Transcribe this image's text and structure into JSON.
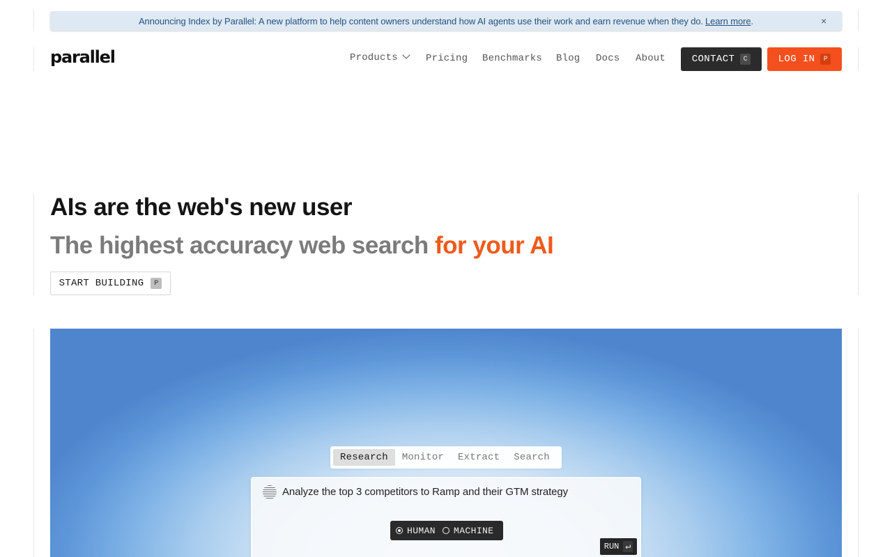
{
  "announcement": {
    "text": "Announcing Index by Parallel: A new platform to help content owners understand how AI agents use their work and earn revenue when they do.",
    "link_label": "Learn more",
    "period": ".",
    "close_glyph": "×"
  },
  "header": {
    "logo": "parallel",
    "nav": {
      "products": "Products",
      "pricing": "Pricing",
      "benchmarks": "Benchmarks",
      "blog": "Blog",
      "docs": "Docs",
      "about": "About"
    },
    "contact": {
      "label": "CONTACT",
      "key": "C"
    },
    "login": {
      "label": "LOG IN",
      "key": "P"
    }
  },
  "hero": {
    "title": "AIs are the web's new user",
    "subtitle_main": "The highest accuracy web search ",
    "subtitle_accent": "for your AI",
    "cta": {
      "label": "START BUILDING",
      "key": "P"
    }
  },
  "demo": {
    "tabs": [
      "Research",
      "Monitor",
      "Extract",
      "Search"
    ],
    "active_tab": "Research",
    "prompt": "Analyze the top 3 competitors to Ramp and their GTM strategy",
    "modes": {
      "human": "HUMAN",
      "machine": "MACHINE",
      "selected": "HUMAN"
    },
    "run": {
      "label": "RUN",
      "glyph": "↵"
    }
  },
  "colors": {
    "accent": "#ef5a1c",
    "login_bg": "#f4501e",
    "contact_bg": "#2b2b2b",
    "announcement_bg": "#dfe9f3"
  }
}
